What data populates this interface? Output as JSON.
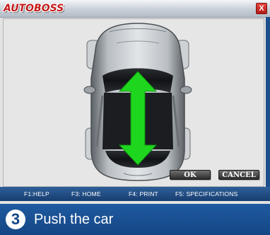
{
  "window": {
    "logo_text": "AUTOBOSS",
    "close_glyph": "X"
  },
  "dialog": {
    "ok_label": "OK",
    "cancel_label": "CANCEL"
  },
  "function_keys": [
    {
      "label": "F1:HELP"
    },
    {
      "label": "F3: HOME"
    },
    {
      "label": "F4: PRINT"
    },
    {
      "label": "F5: SPECIFICATIONS"
    }
  ],
  "instruction": {
    "step_number": "3",
    "text": "Push the car"
  },
  "illustration": {
    "subject": "car-top-view",
    "arrow_icon": "double-arrow-up-down-icon",
    "arrow_color": "#1fd61f",
    "car_color": "#9aa0a6"
  },
  "colors": {
    "accent_blue": "#1a4c8c",
    "logo_red": "#c41a1a"
  }
}
